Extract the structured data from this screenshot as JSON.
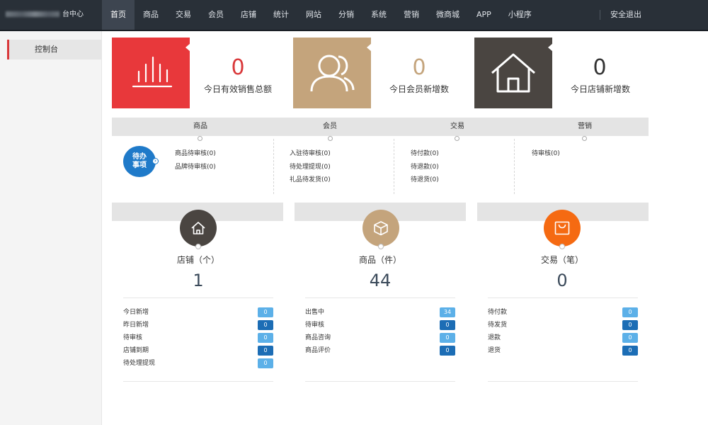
{
  "brand": {
    "suffix": "台中心"
  },
  "nav": {
    "items": [
      "首页",
      "商品",
      "交易",
      "会员",
      "店铺",
      "统计",
      "网站",
      "分销",
      "系统",
      "营销",
      "微商城",
      "APP",
      "小程序"
    ],
    "logout": "安全退出"
  },
  "sidebar": {
    "items": [
      "控制台"
    ]
  },
  "stats": [
    {
      "value": "0",
      "label": "今日有效销售总额",
      "icon": "bar-chart-icon",
      "color": "#e8383b",
      "value_color": "#d9383a"
    },
    {
      "value": "0",
      "label": "今日会员新增数",
      "icon": "users-icon",
      "color": "#c4a47c",
      "value_color": "#c4a47c"
    },
    {
      "value": "0",
      "label": "今日店铺新增数",
      "icon": "home-icon",
      "color": "#4a4541",
      "value_color": "#333333"
    }
  ],
  "todo": {
    "badge": "待办事项",
    "columns": [
      {
        "title": "商品",
        "items": [
          "商品待审核(0)",
          "品牌待审核(0)"
        ]
      },
      {
        "title": "会员",
        "items": [
          "入驻待审核(0)",
          "待处理提现(0)",
          "礼品待发货(0)"
        ]
      },
      {
        "title": "交易",
        "items": [
          "待付款(0)",
          "待退款(0)",
          "待退货(0)"
        ]
      },
      {
        "title": "营销",
        "items": [
          "待审核(0)"
        ]
      }
    ]
  },
  "cards": [
    {
      "title": "店铺（个）",
      "value": "1",
      "icon": "shop-icon",
      "color": "#4a4541",
      "rows": [
        {
          "label": "今日新增",
          "value": "0",
          "style": "light"
        },
        {
          "label": "昨日新增",
          "value": "0",
          "style": "dark"
        },
        {
          "label": "待审核",
          "value": "0",
          "style": "light"
        },
        {
          "label": "店铺到期",
          "value": "0",
          "style": "dark"
        },
        {
          "label": "待处理提现",
          "value": "0",
          "style": "light"
        }
      ]
    },
    {
      "title": "商品（件）",
      "value": "44",
      "icon": "box-icon",
      "color": "#c4a47c",
      "rows": [
        {
          "label": "出售中",
          "value": "34",
          "style": "light"
        },
        {
          "label": "待审核",
          "value": "0",
          "style": "dark"
        },
        {
          "label": "商品咨询",
          "value": "0",
          "style": "light"
        },
        {
          "label": "商品评价",
          "value": "0",
          "style": "dark"
        }
      ]
    },
    {
      "title": "交易（笔）",
      "value": "0",
      "icon": "shopping-bag-icon",
      "color": "#f56a12",
      "rows": [
        {
          "label": "待付款",
          "value": "0",
          "style": "light"
        },
        {
          "label": "待发货",
          "value": "0",
          "style": "dark"
        },
        {
          "label": "退款",
          "value": "0",
          "style": "light"
        },
        {
          "label": "退货",
          "value": "0",
          "style": "dark"
        }
      ]
    }
  ]
}
